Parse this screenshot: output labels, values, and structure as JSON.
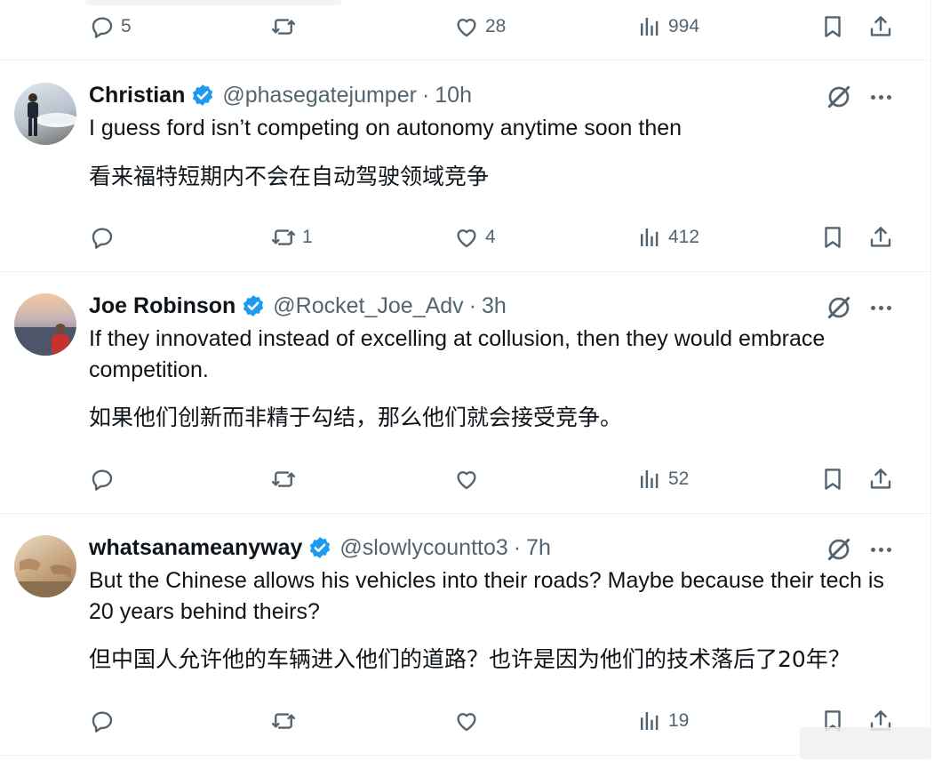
{
  "top_actions": {
    "replies": "5",
    "retweets": "",
    "likes": "28",
    "views": "994"
  },
  "tweets": [
    {
      "name": "Christian",
      "handle": "@phasegatejumper",
      "sep": "·",
      "time": "10h",
      "text_en": "I guess ford isn’t competing on autonomy anytime soon then",
      "text_zh": "看来福特短期内不会在自动驾驶领域竞争",
      "replies": "",
      "retweets": "1",
      "likes": "4",
      "views": "412"
    },
    {
      "name": "Joe Robinson",
      "handle": "@Rocket_Joe_Adv",
      "sep": "·",
      "time": "3h",
      "text_en": "If they innovated instead of excelling at collusion, then they would embrace competition.",
      "text_zh": "如果他们创新而非精于勾结，那么他们就会接受竞争。",
      "replies": "",
      "retweets": "",
      "likes": "",
      "views": "52"
    },
    {
      "name": "whatsanameanyway",
      "handle": "@slowlycountto3",
      "sep": "·",
      "time": "7h",
      "text_en": "But the Chinese allows his vehicles into their roads? Maybe because their tech is 20 years behind theirs?",
      "text_zh": "但中国人允许他的车辆进入他们的道路？也许是因为他们的技术落后了20年？",
      "replies": "",
      "retweets": "",
      "likes": "",
      "views": "19"
    }
  ],
  "colors": {
    "text": "#0f1419",
    "secondary": "#536471",
    "verified": "#1d9bf0",
    "divider": "#eff3f4"
  },
  "icons": [
    "reply-icon",
    "retweet-icon",
    "like-icon",
    "views-icon",
    "bookmark-icon",
    "share-icon",
    "verified-icon",
    "grok-icon",
    "more-icon"
  ]
}
